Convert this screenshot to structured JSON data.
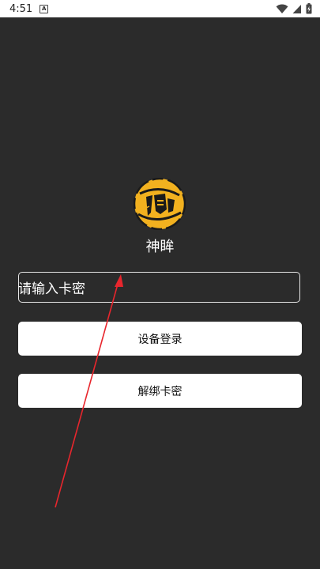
{
  "status_bar": {
    "time": "4:51",
    "icons": [
      "notification-a-icon",
      "wifi-icon",
      "cellular-icon",
      "battery-icon"
    ]
  },
  "app": {
    "name": "神眸"
  },
  "form": {
    "card_input_placeholder": "请输入卡密",
    "login_button": "设备登录",
    "unbind_button": "解绑卡密"
  },
  "colors": {
    "background": "#2b2b2b",
    "button": "#ffffff",
    "annotation_arrow": "#e8262d",
    "logo_gold": "#f2b11f"
  }
}
